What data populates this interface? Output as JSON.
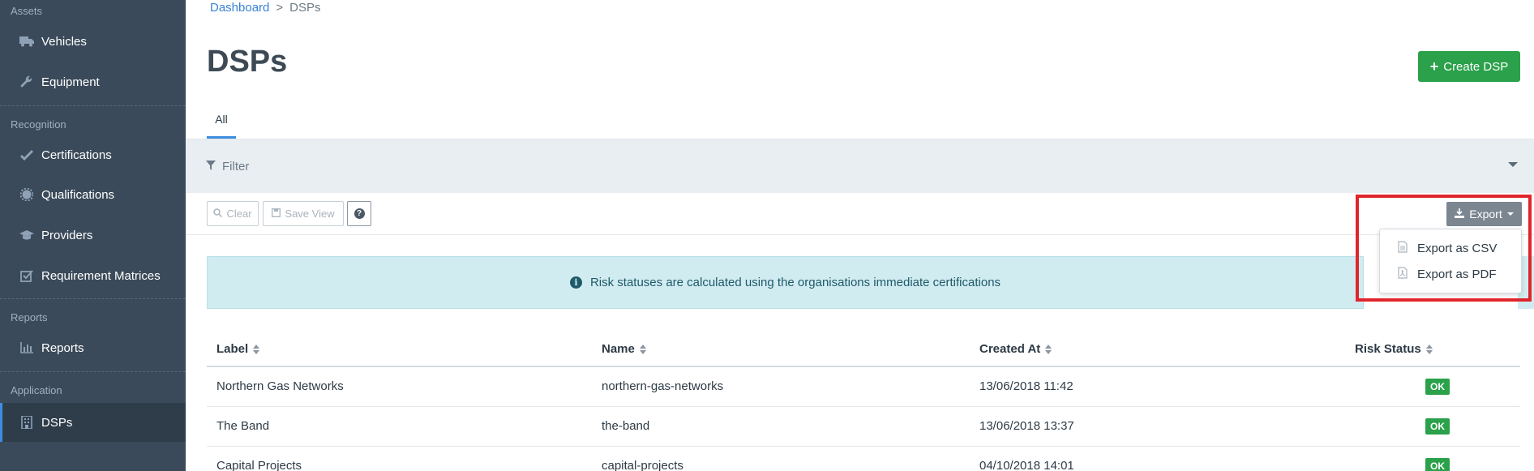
{
  "sidebar": {
    "sections": {
      "assets": "Assets",
      "recognition": "Recognition",
      "reports": "Reports",
      "application": "Application"
    },
    "items": [
      {
        "label": "Vehicles",
        "icon": "truck-icon"
      },
      {
        "label": "Equipment",
        "icon": "wrench-icon"
      },
      {
        "label": "Certifications",
        "icon": "check-icon"
      },
      {
        "label": "Qualifications",
        "icon": "gear-icon"
      },
      {
        "label": "Providers",
        "icon": "graduation-cap-icon"
      },
      {
        "label": "Requirement Matrices",
        "icon": "checkbox-icon"
      },
      {
        "label": "Reports",
        "icon": "bar-chart-icon"
      },
      {
        "label": "DSPs",
        "icon": "building-icon",
        "active": true
      }
    ]
  },
  "breadcrumb": {
    "home": "Dashboard",
    "separator": ">",
    "current": "DSPs"
  },
  "page": {
    "title": "DSPs",
    "create_label": "Create DSP"
  },
  "tabs": [
    {
      "label": "All",
      "active": true
    }
  ],
  "filter": {
    "label": "Filter"
  },
  "toolbar": {
    "clear": "Clear",
    "save_view": "Save View",
    "help": "?"
  },
  "export": {
    "label": "Export",
    "options": [
      {
        "label": "Export as CSV",
        "icon": "file-text-icon"
      },
      {
        "label": "Export as PDF",
        "icon": "file-pdf-icon"
      }
    ]
  },
  "banner": {
    "text": "Risk statuses are calculated using the organisations immediate certifications",
    "icon": "i"
  },
  "table": {
    "columns": [
      "Label",
      "Name",
      "Created At",
      "Risk Status"
    ],
    "rows": [
      {
        "label": "Northern Gas Networks",
        "name": "northern-gas-networks",
        "created_at": "13/06/2018 11:42",
        "risk": "OK"
      },
      {
        "label": "The Band",
        "name": "the-band",
        "created_at": "13/06/2018 13:37",
        "risk": "OK"
      },
      {
        "label": "Capital Projects",
        "name": "capital-projects",
        "created_at": "04/10/2018 14:01",
        "risk": "OK"
      }
    ]
  },
  "colors": {
    "sidebar_bg": "#3b4a5a",
    "accent": "#3d8de0",
    "success": "#2aa14a",
    "highlight": "#e0252b"
  }
}
